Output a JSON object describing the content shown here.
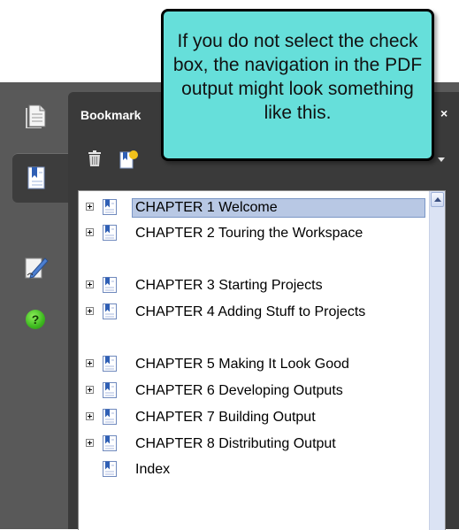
{
  "panel": {
    "title": "Bookmark",
    "close_label": "×"
  },
  "toolbar": {
    "icons": [
      "trash-icon",
      "new-bookmark-icon"
    ],
    "options_icon": "chevron-down-icon"
  },
  "rail": {
    "icons": [
      "pages-icon",
      "bookmarks-icon",
      "signature-icon",
      "help-icon"
    ],
    "active": "bookmarks-icon",
    "help_glyph": "?"
  },
  "callout": {
    "text": "If you do not select the check box, the navigation in the PDF output might look something like this."
  },
  "bookmarks": [
    {
      "label": "CHAPTER 1 Welcome",
      "expandable": true,
      "selected": true
    },
    {
      "label": "CHAPTER 2 Touring the Workspace",
      "expandable": true,
      "selected": false
    },
    {
      "label": "CHAPTER 3 Starting Projects",
      "expandable": true,
      "selected": false
    },
    {
      "label": "CHAPTER 4 Adding Stuff to Projects",
      "expandable": true,
      "selected": false
    },
    {
      "label": "CHAPTER 5 Making It Look Good",
      "expandable": true,
      "selected": false
    },
    {
      "label": "CHAPTER 6 Developing Outputs",
      "expandable": true,
      "selected": false
    },
    {
      "label": "CHAPTER 7 Building Output",
      "expandable": true,
      "selected": false
    },
    {
      "label": "CHAPTER 8 Distributing Output",
      "expandable": true,
      "selected": false
    },
    {
      "label": "Index",
      "expandable": false,
      "selected": false
    }
  ],
  "colors": {
    "callout_fill": "#66dfda",
    "selection": "#b8c8e4",
    "frame": "#595959",
    "panel": "#3a3a3a",
    "help_green": "#3cb81e"
  }
}
